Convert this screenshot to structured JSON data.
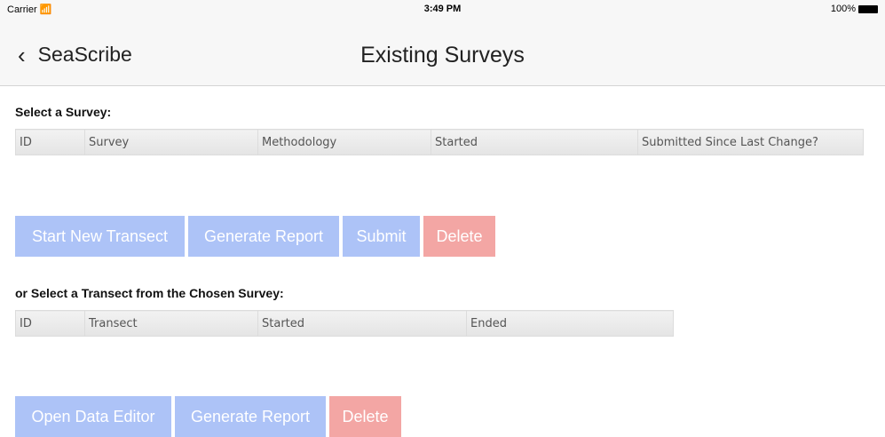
{
  "status": {
    "carrier": "Carrier",
    "wifi_icon": "wifi-icon",
    "time": "3:49 PM",
    "battery_text": "100%"
  },
  "nav": {
    "back_label": "SeaScribe",
    "title": "Existing Surveys"
  },
  "survey_section": {
    "label": "Select a Survey:",
    "columns": [
      "ID",
      "Survey",
      "Methodology",
      "Started",
      "Submitted Since Last Change?"
    ],
    "buttons": {
      "start_transect": "Start New Transect",
      "generate_report": "Generate Report",
      "submit": "Submit",
      "delete": "Delete"
    }
  },
  "transect_section": {
    "label": "or Select a Transect from the Chosen Survey:",
    "columns": [
      "ID",
      "Transect",
      "Started",
      "Ended"
    ],
    "buttons": {
      "open_editor": "Open Data Editor",
      "generate_report": "Generate Report",
      "delete": "Delete"
    }
  },
  "colors": {
    "primary_button": "#adc3f7",
    "danger_button": "#f3a6a4",
    "nav_bg": "#f7f7f7"
  }
}
